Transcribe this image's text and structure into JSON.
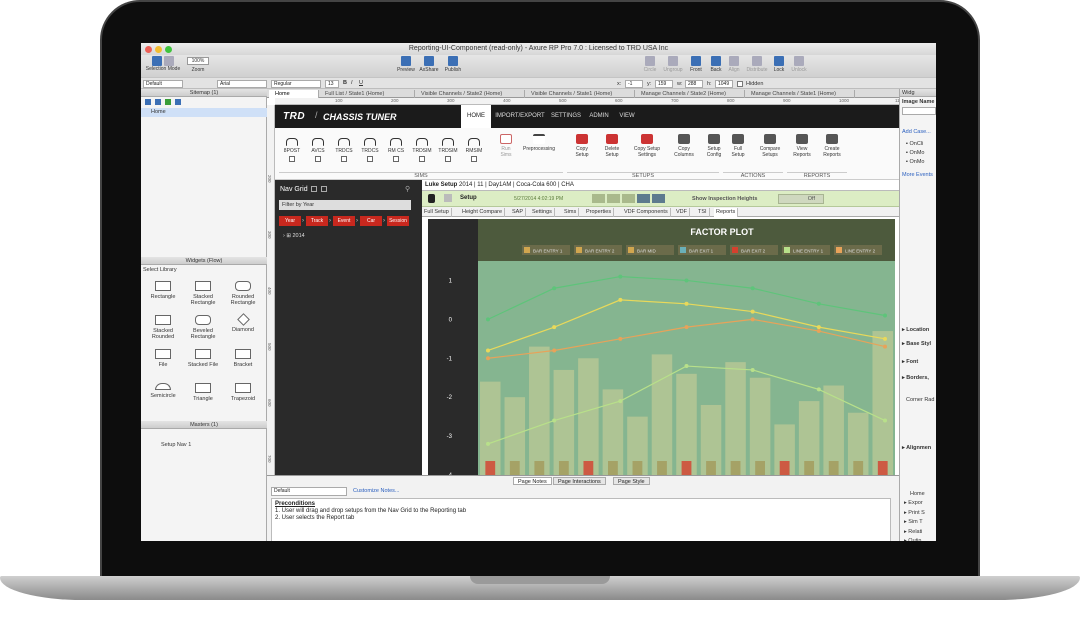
{
  "window": {
    "title": "Reporting-UI-Component (read-only) - Axure RP Pro 7.0 : Licensed to TRD USA Inc"
  },
  "toolbar": {
    "selection_mode": "Selection Mode",
    "zoom": "Zoom",
    "zoom_value": "100%",
    "preview": "Preview",
    "axshare": "AxShare",
    "publish": "Publish",
    "circle": "Circle",
    "ungroup": "Ungroup",
    "front": "Front",
    "back": "Back",
    "align": "Align",
    "distribute": "Distribute",
    "lock": "Lock",
    "unlock": "Unlock"
  },
  "format_bar": {
    "style": "Default",
    "font": "Arial",
    "weight": "Regular",
    "size": "13",
    "x_label": "x:",
    "x": "-1",
    "y_label": "y:",
    "y": "159",
    "w_label": "w:",
    "w": "288",
    "h_label": "h:",
    "h": "1049",
    "hidden": "Hidden"
  },
  "sitemap": {
    "title": "Sitemap (1)",
    "items": [
      "Home"
    ]
  },
  "widgets": {
    "title": "Widgets (Flow)",
    "select_library": "Select Library",
    "items": [
      "Rectangle",
      "Stacked Rectangle",
      "Rounded Rectangle",
      "Stacked Rounded",
      "Beveled Rectangle",
      "Diamond",
      "File",
      "Stacked File",
      "Bracket",
      "Semicircle",
      "Triangle",
      "Trapezoid"
    ]
  },
  "masters": {
    "title": "Masters (1)",
    "items": [
      "Setup Nav 1"
    ]
  },
  "tabs": [
    "Home",
    "Full List / State1 (Home)",
    "Visible Channels / State2 (Home)",
    "Visible Channels / State1 (Home)",
    "Manage Channels / State2 (Home)",
    "Manage Channels / State1 (Home)"
  ],
  "rulers": {
    "top": [
      "100",
      "200",
      "300",
      "400",
      "500",
      "600",
      "700",
      "800",
      "900",
      "1000",
      "1100"
    ],
    "left": [
      "200",
      "300",
      "400",
      "500",
      "600",
      "700"
    ]
  },
  "app": {
    "logo": "TRD",
    "title": "CHASSIS TUNER",
    "menu": [
      "HOME",
      "IMPORT/EXPORT",
      "SETTINGS",
      "ADMIN",
      "VIEW"
    ],
    "sims": [
      "8POST",
      "AVCS",
      "TRDCS",
      "TRDCS",
      "RM CS",
      "TRDSIM",
      "TRDSIM",
      "RMSIM"
    ],
    "run_sims": "Run Sims",
    "preprocessing": "Preprocessing",
    "setups": [
      "Copy Setup",
      "Delete Setup",
      "Copy Setup Settings",
      "Copy Columns",
      "Setup Config"
    ],
    "actions": [
      "Full Setup",
      "Compare Setups"
    ],
    "reports": [
      "View Reports",
      "Create Reports"
    ],
    "groups": {
      "sims": "SIMS",
      "setups": "SETUPS",
      "actions": "ACTIONS",
      "reports": "REPORTS"
    }
  },
  "navgrid": {
    "title": "Nav Grid",
    "filter": "Filter by Year",
    "chips": [
      "Year",
      "Track",
      "Event",
      "Car",
      "Session"
    ],
    "year": "2014"
  },
  "detail": {
    "header_bold": "Luke Setup",
    "header_rest": "2014 | 11 | Day1AM | Coca-Cola 600 | CHA",
    "setup_label": "Setup",
    "date": "5/27/2014 4:02:19 PM",
    "show_inspection": "Show Inspection Heights",
    "toggle": "Off",
    "subtabs": [
      "Full Setup",
      "Height Compare",
      "SAP",
      "Settings",
      "Sims",
      "Properties",
      "VDF Components",
      "VDF",
      "TSI",
      "Reports"
    ]
  },
  "chart_data": {
    "type": "line",
    "title": "FACTOR PLOT",
    "yticks": [
      "1",
      "0",
      "-1",
      "-2",
      "-3",
      "-4"
    ],
    "ylim": [
      -4,
      1.5
    ],
    "legend": [
      "BAR ENTRY 1",
      "BAR ENTRY 2",
      "BAR MID",
      "BAR EXIT 1",
      "BAR EXIT 2",
      "LINE ENTRY 1",
      "LINE ENTRY 2"
    ],
    "colors": {
      "green": "#6fcf8e",
      "yellow": "#e9d95a",
      "orange": "#e7a35a",
      "red": "#d4402e",
      "bar": "#cfcf98"
    },
    "series": [
      {
        "color": "#5ec47a",
        "values": [
          0,
          0.8,
          1.1,
          1.0,
          0.8,
          0.4,
          0.1
        ]
      },
      {
        "color": "#e9d95a",
        "values": [
          -0.8,
          -0.2,
          0.5,
          0.4,
          0.2,
          -0.2,
          -0.5
        ]
      },
      {
        "color": "#e7a35a",
        "values": [
          -1.0,
          -0.8,
          -0.5,
          -0.2,
          0.0,
          -0.3,
          -0.7
        ]
      },
      {
        "color": "#b8e08a",
        "values": [
          -3.2,
          -2.6,
          -2.1,
          -1.2,
          -1.3,
          -1.8,
          -2.6
        ]
      }
    ],
    "bars": [
      -1.6,
      -2.0,
      -0.7,
      -1.3,
      -1.0,
      -1.8,
      -2.5,
      -0.9,
      -1.4,
      -2.2,
      -1.1,
      -1.5,
      -2.7,
      -2.1,
      -1.7,
      -2.4,
      -0.3
    ]
  },
  "notes": {
    "tabs": [
      "Page Notes",
      "Page Interactions",
      "Page Style"
    ],
    "select": "Default",
    "customize": "Customize Notes...",
    "heading": "Preconditions",
    "lines": [
      "1. User will drag and drop setups from the Nav Grid to the Reporting tab",
      "2. User selects the Report tab"
    ]
  },
  "right_panel": {
    "title": "Widg",
    "image_name": "Image Name",
    "add_case": "Add Case...",
    "events": [
      "OnCli",
      "OnMo",
      "OnMo"
    ],
    "more_events": "More Events",
    "sections": [
      "Location",
      "Base Styl",
      "Font",
      "Borders,",
      "Alignmen"
    ],
    "corner_radius": "Corner Rad",
    "outline_title": "Home",
    "outline": [
      "Expor",
      "Print S",
      "Sim T",
      "Relati",
      "Outin",
      "Outin",
      "Sensit",
      "Mana",
      "St"
    ]
  }
}
